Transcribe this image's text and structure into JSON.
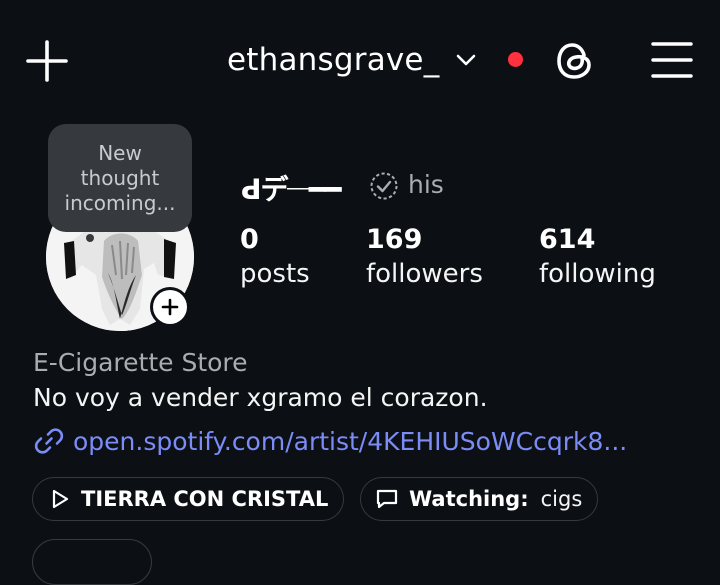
{
  "header": {
    "username": "ethansgrave_",
    "has_notification": true,
    "accent_red": "#ff3040"
  },
  "profile": {
    "display_name": "ꓒデ𝄖━━",
    "pronouns": "his",
    "note": "New\nthought\nincoming..."
  },
  "stats": {
    "posts": {
      "count": "0",
      "label": "posts"
    },
    "followers": {
      "count": "169",
      "label": "followers"
    },
    "following": {
      "count": "614",
      "label": "following"
    }
  },
  "bio": {
    "category": "E-Cigarette Store",
    "text": "No voy a vender xgramo el corazon.",
    "link": "open.spotify.com/artist/4KEHIUSoWCcqrk8...",
    "link_color": "#7b8cf6"
  },
  "chips": {
    "music": {
      "label": "TIERRA CON CRISTAL",
      "icon": "play-icon"
    },
    "watching": {
      "label": "Watching:",
      "value": "cigs",
      "icon": "chat-bubble-icon"
    }
  }
}
